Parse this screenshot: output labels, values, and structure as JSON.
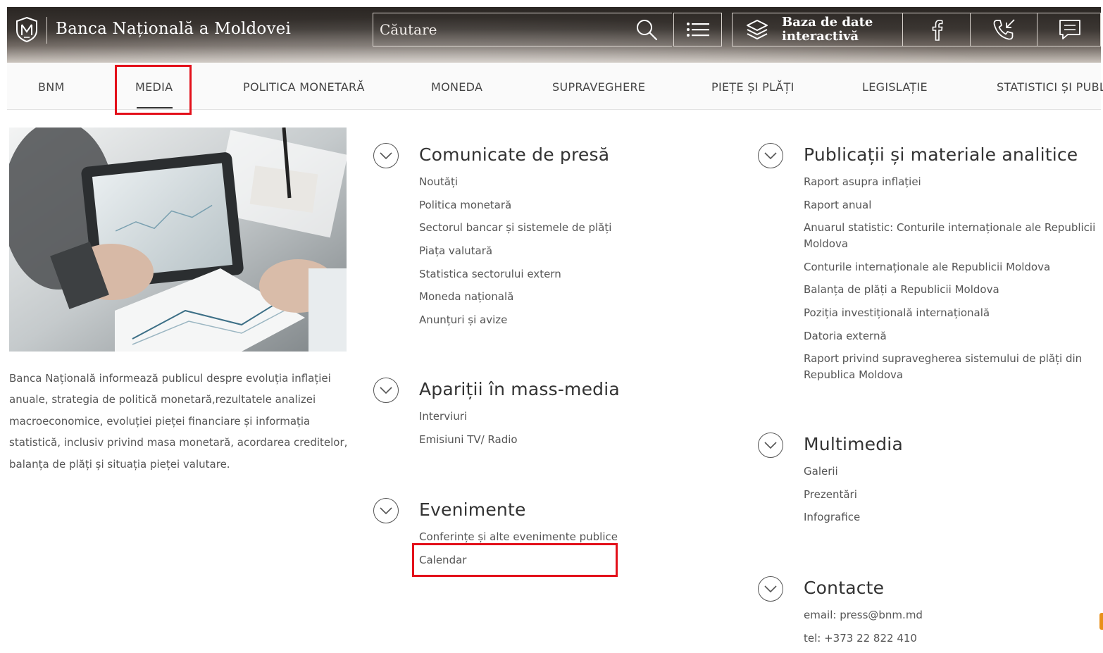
{
  "header": {
    "brand": "Banca Națională a Moldovei",
    "search_placeholder": "Căutare",
    "database_label": "Baza de date interactivă",
    "icons": [
      "bnm-logo-icon",
      "search-icon",
      "list-menu-icon",
      "layers-icon",
      "facebook-icon",
      "phone-icon",
      "chat-icon"
    ]
  },
  "nav": {
    "items": [
      "BNM",
      "MEDIA",
      "POLITICA MONETARĂ",
      "MONEDA",
      "SUPRAVEGHERE",
      "PIEȚE ȘI PLĂȚI",
      "LEGISLAȚIE",
      "STATISTICI ȘI PUBL"
    ],
    "active": "MEDIA"
  },
  "intro": {
    "text": "Banca Națională informează publicul despre evoluția inflației anuale, strategia de politică monetară,rezultatele analizei macroeconomice, evoluției pieței financiare și informația statistică, inclusiv privind masa monetară, acordarea creditelor, balanța de plăți și situația pieței valutare."
  },
  "sections": {
    "press": {
      "title": "Comunicate de presă",
      "links": [
        "Noutăți",
        "Politica monetară",
        "Sectorul bancar și sistemele de plăți",
        "Piața valutară",
        "Statistica sectorului extern",
        "Moneda națională",
        "Anunțuri și avize"
      ]
    },
    "media": {
      "title": "Apariții în mass-media",
      "links": [
        "Interviuri",
        "Emisiuni TV/ Radio"
      ]
    },
    "events": {
      "title": "Evenimente",
      "links": [
        "Conferințe și alte evenimente publice",
        "Calendar"
      ]
    },
    "publications": {
      "title": "Publicații și materiale analitice",
      "links": [
        "Raport asupra inflației",
        "Raport anual",
        "Anuarul statistic: Conturile internaționale ale Republicii Moldova",
        "Conturile internaționale ale Republicii Moldova",
        "Balanța de plăți a Republicii Moldova",
        "Poziția investițională internațională",
        "Datoria externă",
        "Raport privind supravegherea sistemului de plăți din Republica Moldova"
      ]
    },
    "multimedia": {
      "title": "Multimedia",
      "links": [
        "Galerii",
        "Prezentări",
        "Infografice"
      ]
    },
    "contacts": {
      "title": "Contacte",
      "links": [
        "email: press@bnm.md",
        "tel: +373 22 822 410"
      ]
    }
  },
  "colors": {
    "highlight": "#e3101a",
    "header_dark": "#2a2623",
    "text": "#555555",
    "nav_bg": "#fafafa"
  }
}
